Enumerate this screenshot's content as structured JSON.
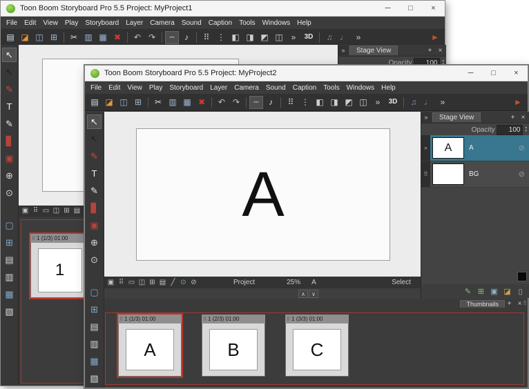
{
  "shared": {
    "window_controls": {
      "minimize": "─",
      "maximize": "□",
      "close": "×"
    },
    "stage_tab": "Stage View",
    "opacity_label": "Opacity",
    "tab_add": "+",
    "tab_close": "×",
    "panel_collapse": "»",
    "collapse_up": "∧",
    "collapse_down": "∨",
    "spinner_up": "▴",
    "spinner_down": "▾",
    "layer_eye": "⊘",
    "grip_dots": "⠿",
    "menu": [
      {
        "label": "File"
      },
      {
        "label": "Edit"
      },
      {
        "label": "View"
      },
      {
        "label": "Play"
      },
      {
        "label": "Storyboard"
      },
      {
        "label": "Layer"
      },
      {
        "label": "Camera"
      },
      {
        "label": "Sound"
      },
      {
        "label": "Caption"
      },
      {
        "label": "Tools"
      },
      {
        "label": "Windows"
      },
      {
        "label": "Help"
      }
    ],
    "toolbar": [
      {
        "name": "new-project-icon",
        "glyph": "▤",
        "color": "#cfe0f0"
      },
      {
        "name": "open-project-icon",
        "glyph": "◪",
        "color": "#e2973b"
      },
      {
        "name": "save-icon",
        "glyph": "◫",
        "color": "#9db8d6"
      },
      {
        "name": "save-all-icon",
        "glyph": "⊞",
        "color": "#9db8d6"
      },
      {
        "name": "toolbar-separator",
        "sep": true
      },
      {
        "name": "cut-icon",
        "glyph": "✂",
        "color": "#cfe0f0"
      },
      {
        "name": "copy-icon",
        "glyph": "▥",
        "color": "#9db8d6"
      },
      {
        "name": "paste-icon",
        "glyph": "▦",
        "color": "#9db8d6"
      },
      {
        "name": "delete-icon",
        "glyph": "✖",
        "color": "#cc3b2f"
      },
      {
        "name": "toolbar-separator",
        "sep": true
      },
      {
        "name": "undo-icon",
        "glyph": "↶",
        "color": "#c0c0c0"
      },
      {
        "name": "redo-icon",
        "glyph": "↷",
        "color": "#c0c0c0"
      },
      {
        "name": "toolbar-separator",
        "sep": true
      },
      {
        "name": "panel-view-icon",
        "glyph": "┄",
        "color": "#e8e8e8",
        "pressed": true
      },
      {
        "name": "sound-clef-icon",
        "glyph": "♪",
        "color": "#e0e0e0"
      },
      {
        "name": "toolbar-separator",
        "sep": true
      },
      {
        "name": "grid-icon",
        "glyph": "⠿",
        "color": "#cfcfcf"
      },
      {
        "name": "dots-icon",
        "glyph": "⋮",
        "color": "#cfcfcf"
      },
      {
        "name": "layout-left-icon",
        "glyph": "◧",
        "color": "#cfcfcf"
      },
      {
        "name": "layout-right-icon",
        "glyph": "◨",
        "color": "#cfcfcf"
      },
      {
        "name": "layout-top-icon",
        "glyph": "◩",
        "color": "#cfcfcf"
      },
      {
        "name": "layout-split-icon",
        "glyph": "◫",
        "color": "#cfcfcf"
      },
      {
        "name": "toolbar-overflow-icon",
        "glyph": "»",
        "color": "#cfcfcf"
      },
      {
        "name": "3d-mode-icon",
        "glyph": "3D",
        "color": "#e6e6e6",
        "wide": true
      },
      {
        "name": "toolbar-separator",
        "sep": true
      },
      {
        "name": "sound-scrub-icon",
        "glyph": "♫",
        "color": "#7c94b8"
      },
      {
        "name": "audio-playback-icon",
        "glyph": "♩",
        "color": "#7c94b8"
      },
      {
        "name": "toolbar-overflow-icon",
        "glyph": "»",
        "color": "#cfcfcf"
      },
      {
        "name": "announcement-horn-icon",
        "glyph": "►",
        "color": "#c8502e",
        "pushR": true
      }
    ],
    "tools": [
      {
        "name": "select-tool-icon",
        "glyph": "↖",
        "color": "#f2f2f2",
        "pressed": true
      },
      {
        "name": "transform-tool-icon",
        "glyph": "↖",
        "color": "#1f1f1f"
      },
      {
        "name": "pencil-tool-icon",
        "glyph": "✎",
        "color": "#c94c3b"
      },
      {
        "name": "text-tool-icon",
        "glyph": "T",
        "color": "#f0f0f0"
      },
      {
        "name": "pen-tool-icon",
        "glyph": "✎",
        "color": "#e6e6e6"
      },
      {
        "name": "brush-tool-icon",
        "glyph": "▊",
        "color": "#b5443a"
      },
      {
        "name": "stamp-tool-icon",
        "glyph": "▣",
        "color": "#b5443a"
      },
      {
        "name": "hand-tool-icon",
        "glyph": "⊕",
        "color": "#d8d8d8"
      },
      {
        "name": "zoom-tool-icon",
        "glyph": "⊙",
        "color": "#d8d8d8"
      }
    ],
    "panel_tools": [
      {
        "name": "panel-select-icon",
        "glyph": "▢",
        "color": "#7fa8c9"
      },
      {
        "name": "new-panel-icon",
        "glyph": "⊞",
        "color": "#7fa8c9"
      },
      {
        "name": "add-panel-icon",
        "glyph": "▤",
        "color": "#d8d8d8"
      },
      {
        "name": "duplicate-panel-icon",
        "glyph": "▥",
        "color": "#d8d8d8"
      },
      {
        "name": "film-strip-icon",
        "glyph": "▦",
        "color": "#7fa8c9"
      },
      {
        "name": "pages-icon",
        "glyph": "▧",
        "color": "#d8d8d8"
      }
    ],
    "canvasbar_icons": [
      {
        "name": "reset-view-icon",
        "glyph": "▣",
        "color": "#c2c2c2"
      },
      {
        "name": "show-grid-icon",
        "glyph": "⠿",
        "color": "#c2c2c2"
      },
      {
        "name": "safe-area-icon",
        "glyph": "▭",
        "color": "#c2c2c2"
      },
      {
        "name": "camera-mask-icon",
        "glyph": "◫",
        "color": "#c2c2c2"
      },
      {
        "name": "field-grid-icon",
        "glyph": "⊞",
        "color": "#c2c2c2"
      },
      {
        "name": "proportion-grid-icon",
        "glyph": "▤",
        "color": "#c2c2c2"
      },
      {
        "name": "line-art-icon",
        "glyph": "╱",
        "color": "#c2c2c2"
      },
      {
        "name": "onion-skin-icon",
        "glyph": "⊙",
        "color": "#7fa8c9"
      },
      {
        "name": "light-table-icon",
        "glyph": "⊘",
        "color": "#c2c2c2"
      }
    ]
  },
  "win1": {
    "title": "Toon Boom Storyboard Pro 5.5 Project: MyProject1",
    "opacity_value": "100",
    "panel": {
      "header": "1 (1/3) 01:00",
      "grip": "⠿",
      "letter": "1"
    }
  },
  "win2": {
    "title": "Toon Boom Storyboard Pro 5.5 Project: MyProject2",
    "opacity_value": "100",
    "canvas_letter": "A",
    "layers": [
      {
        "name": "A",
        "letter": "A",
        "grip": "»",
        "selected": true
      },
      {
        "name": "BG",
        "letter": "",
        "grip": "⠿",
        "selected": false
      }
    ],
    "layer_footer": [
      {
        "name": "add-vector-layer-icon",
        "glyph": "✎",
        "color": "#7ec47e"
      },
      {
        "name": "add-bitmap-layer-icon",
        "glyph": "⊞",
        "color": "#7ec47e"
      },
      {
        "name": "duplicate-layer-icon",
        "glyph": "▣",
        "color": "#8fb3c9"
      },
      {
        "name": "import-images-icon",
        "glyph": "◪",
        "color": "#c9a24b"
      },
      {
        "name": "delete-layer-icon",
        "glyph": "▯",
        "color": "#b0b0b0"
      }
    ],
    "status": {
      "project_label": "Project",
      "zoom": "25%",
      "current_layer": "A",
      "tool": "Select"
    },
    "thumbs_tab": "Thumbnails",
    "panels": [
      {
        "header": "1 (1/3) 01:00",
        "grip": "⠿",
        "letter": "A",
        "selected": true
      },
      {
        "header": "1 (2/3) 01:00",
        "grip": "⠿",
        "letter": "B",
        "selected": false
      },
      {
        "header": "1 (3/3) 01:00",
        "grip": "⠿",
        "letter": "C",
        "selected": false
      }
    ]
  }
}
